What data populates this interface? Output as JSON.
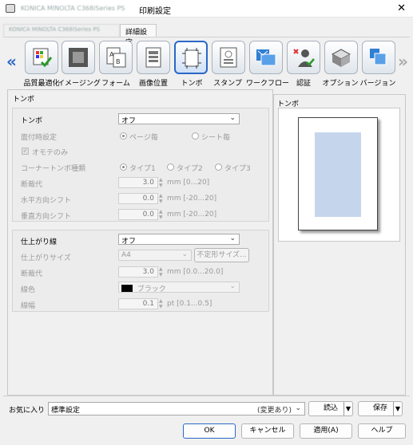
{
  "window": {
    "app_name": "KONICA MINOLTA C368iSeries PS",
    "title": "印刷設定",
    "close_glyph": "✕"
  },
  "tabs": [
    {
      "label": "KONICA MINOLTA C368iSeries PS"
    },
    {
      "label": "詳細設定"
    }
  ],
  "toolbar": {
    "left_arrow": "«",
    "right_arrow": "»",
    "items": [
      {
        "label": "品質最適化",
        "icon": "quality-icon"
      },
      {
        "label": "イメージング",
        "icon": "imaging-icon"
      },
      {
        "label": "フォーム",
        "icon": "form-icon"
      },
      {
        "label": "画像位置",
        "icon": "image-position-icon"
      },
      {
        "label": "トンボ",
        "icon": "crop-marks-icon"
      },
      {
        "label": "スタンプ",
        "icon": "stamp-icon"
      },
      {
        "label": "ワークフロー",
        "icon": "workflow-icon"
      },
      {
        "label": "認証",
        "icon": "auth-icon"
      },
      {
        "label": "オプション",
        "icon": "option-icon"
      },
      {
        "label": "バージョン",
        "icon": "version-icon"
      }
    ]
  },
  "left_panel": {
    "title": "トンボ",
    "crop": {
      "label": "トンボ",
      "value": "オフ",
      "print_face_label": "面付時設定",
      "print_face_options": [
        "ページ毎",
        "シート毎"
      ],
      "front_only_label": "オモテのみ",
      "corner_type_label": "コーナートンボ種類",
      "corner_type_options": [
        "タイプ1",
        "タイプ2",
        "タイプ3"
      ],
      "bleed_label": "断裁代",
      "bleed_value": "3.0",
      "bleed_unit": "mm [0...20]",
      "hshift_label": "水平方向シフト",
      "hshift_value": "0.0",
      "hshift_unit": "mm [-20...20]",
      "vshift_label": "垂直方向シフト",
      "vshift_value": "0.0",
      "vshift_unit": "mm [-20...20]"
    },
    "finish": {
      "label": "仕上がり線",
      "value": "オフ",
      "size_label": "仕上がりサイズ",
      "size_value": "A4",
      "custom_size_button": "不定形サイズ...",
      "bleed_label": "断裁代",
      "bleed_value": "3.0",
      "bleed_unit": "mm [0.0...20.0]",
      "color_label": "線色",
      "color_value": "ブラック",
      "color_swatch": "#000000",
      "width_label": "線幅",
      "width_value": "0.1",
      "width_unit": "pt [0.1...0.5]"
    }
  },
  "preview": {
    "title": "トンボ",
    "paper_color": "#c5d6ec"
  },
  "favorites": {
    "label": "お気に入り",
    "value": "標準設定",
    "changed_note": "(変更あり)",
    "load_button": "読込",
    "save_button": "保存"
  },
  "footer": {
    "ok": "OK",
    "cancel": "キャンセル",
    "apply": "適用(A)",
    "help": "ヘルプ"
  },
  "colors": {
    "accent": "#2a68c6"
  }
}
